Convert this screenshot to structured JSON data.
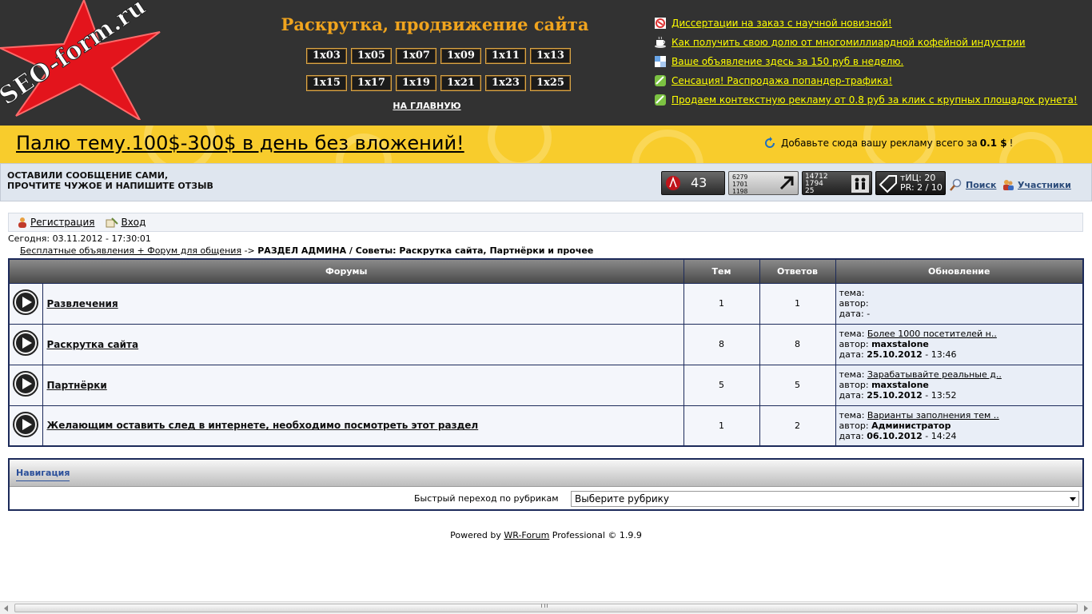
{
  "header": {
    "logo_text": "SEO-form.ru",
    "site_title": "Раскрутка, продвижение сайта",
    "episodes_row1": [
      "1x03",
      "1x05",
      "1x07",
      "1x09",
      "1x11",
      "1x13"
    ],
    "episodes_row2": [
      "1x15",
      "1x17",
      "1x19",
      "1x21",
      "1x23",
      "1x25"
    ],
    "to_main": "НА ГЛАВНУЮ",
    "ad_links": [
      {
        "text": "Диссертации на заказ с научной новизной!",
        "icon": "tag-icon"
      },
      {
        "text": "Как получить свою долю от многомиллиардной кофейной индустрии",
        "icon": "coffee-cup-icon"
      },
      {
        "text": "Ваше объявление здесь за 150 руб в неделю.",
        "icon": "ad-block-icon"
      },
      {
        "text": "Сенсация! Распродажа попандер-трафика!",
        "icon": "green-check-icon"
      },
      {
        "text": "Продаем контекстную рекламу от 0.8 руб за клик с крупных площадок рунета!",
        "icon": "green-check-icon"
      }
    ]
  },
  "banner": {
    "main_text": "Палю тему.100$-300$ в день без вложений!",
    "right_prefix": "Добавьте сюда вашу рекламу всего за",
    "right_price": "0.1 $",
    "right_suffix": "!"
  },
  "slogan_bar": {
    "line1": "ОСТАВИЛИ СООБЩЕНИЕ САМИ,",
    "line2": "ПРОЧТИТЕ ЧУЖОЕ И НАПИШИТЕ ОТЗЫВ",
    "counter1": "43",
    "counter2": [
      "6279",
      "1701",
      "1198"
    ],
    "counter3": [
      "14712",
      "1794",
      "25"
    ],
    "counter4_line1": "тИЦ: 20",
    "counter4_line2": "PR: 2 / 10",
    "search": "Поиск",
    "members": "Участники"
  },
  "userbar": {
    "register": "Регистрация",
    "login": "Вход"
  },
  "today": "Сегодня: 03.11.2012 - 17:30:01",
  "breadcrumb": {
    "link": "Бесплатные объявления + Форум для общения",
    "sep": "->",
    "current": "РАЗДЕЛ АДМИНА / Советы: Раскрутка сайта, Партнёрки и прочее"
  },
  "forums": {
    "headers": {
      "forums": "Форумы",
      "topics": "Тем",
      "replies": "Ответов",
      "update": "Обновление"
    },
    "labels": {
      "topic": "тема:",
      "author": "автор:",
      "date": "дата:"
    },
    "rows": [
      {
        "name": "Развлечения",
        "topics": "1",
        "replies": "1",
        "upd_topic": "",
        "upd_author": "",
        "upd_date": "-",
        "upd_time": ""
      },
      {
        "name": "Раскрутка сайта",
        "topics": "8",
        "replies": "8",
        "upd_topic": "Более 1000 посетителей н..",
        "upd_author": "maxstalone",
        "upd_date": "25.10.2012",
        "upd_time": " - 13:46"
      },
      {
        "name": "Партнёрки",
        "topics": "5",
        "replies": "5",
        "upd_topic": "Зарабатывайте реальные д..",
        "upd_author": "maxstalone",
        "upd_date": "25.10.2012",
        "upd_time": " - 13:52"
      },
      {
        "name": "Желающим оставить след в интернете, необходимо посмотреть этот раздел",
        "topics": "1",
        "replies": "2",
        "upd_topic": "Варианты заполнения тем ..",
        "upd_author": "Администратор",
        "upd_date": "06.10.2012",
        "upd_time": " - 14:24"
      }
    ]
  },
  "navigation": {
    "tab": "Навигация",
    "jump_label": "Быстрый переход по рубрикам",
    "jump_selected": "Выберите рубрику"
  },
  "footer": {
    "prefix": "Powered by",
    "link": "WR-Forum",
    "suffix": "Professional © 1.9.9"
  },
  "colors": {
    "header_bg": "#323232",
    "accent_orange": "#f0a41e",
    "link_yellow": "#ffff00",
    "banner_yellow": "#f8cc2c",
    "table_border": "#1c2a5a"
  }
}
